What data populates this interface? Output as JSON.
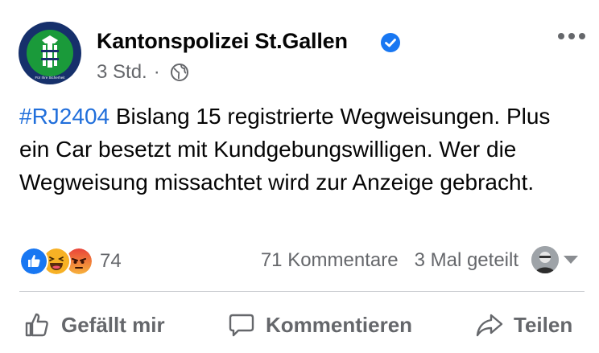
{
  "post": {
    "author": "Kantonspolizei St.Gallen",
    "timestamp": "3 Std.",
    "separator": "·",
    "hashtag": "#RJ2404",
    "text": " Bislang 15 registrierte Wegweisungen. Plus ein Car besetzt mit Kundgebungswilligen. Wer die Wegweisung missachtet wird zur Anzeige gebracht.",
    "avatar_ring_text": "KANTONSPOLIZEI ST.GALLEN",
    "avatar_motto": "Für Ihre Sicherheit"
  },
  "reactions": {
    "types": [
      "like-icon",
      "haha-icon",
      "angry-icon"
    ],
    "count": "74"
  },
  "stats": {
    "comments": "71 Kommentare",
    "shares": "3 Mal geteilt"
  },
  "actions": {
    "like": "Gefällt mir",
    "comment": "Kommentieren",
    "share": "Teilen"
  },
  "colors": {
    "link": "#216fdb",
    "secondary_text": "#65676b",
    "verified": "#1877f2",
    "badge_green": "#1a9a3a",
    "badge_navy": "#16306b"
  }
}
